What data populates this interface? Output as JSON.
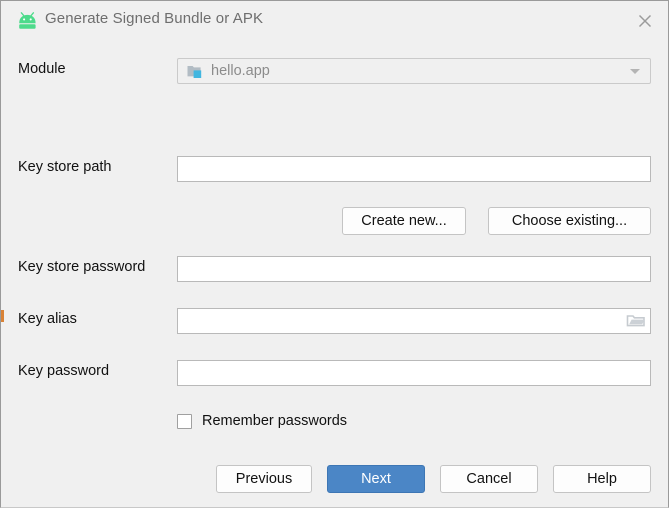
{
  "window": {
    "title": "Generate Signed Bundle or APK",
    "app_icon": "android-robot-icon",
    "close_icon": "close-icon",
    "background_color": "#f0f0f0",
    "title_color": "#6e6e6e"
  },
  "form": {
    "module": {
      "label": "Module",
      "value": "hello.app",
      "icon": "module-folder-icon",
      "dropdown_icon": "chevron-down-icon",
      "enabled": false
    },
    "key_store_path": {
      "label": "Key store path",
      "value": "",
      "placeholder": ""
    },
    "key_store_buttons": {
      "create_new": "Create new...",
      "choose_existing": "Choose existing..."
    },
    "key_store_password": {
      "label": "Key store password",
      "value": "",
      "placeholder": ""
    },
    "key_alias": {
      "label": "Key alias",
      "value": "",
      "placeholder": "",
      "browse_icon": "folder-icon"
    },
    "key_password": {
      "label": "Key password",
      "value": "",
      "placeholder": ""
    },
    "remember_passwords": {
      "label": "Remember passwords",
      "checked": false
    }
  },
  "footer": {
    "previous": "Previous",
    "next": "Next",
    "cancel": "Cancel",
    "help": "Help",
    "primary_color": "#4b86c6"
  }
}
